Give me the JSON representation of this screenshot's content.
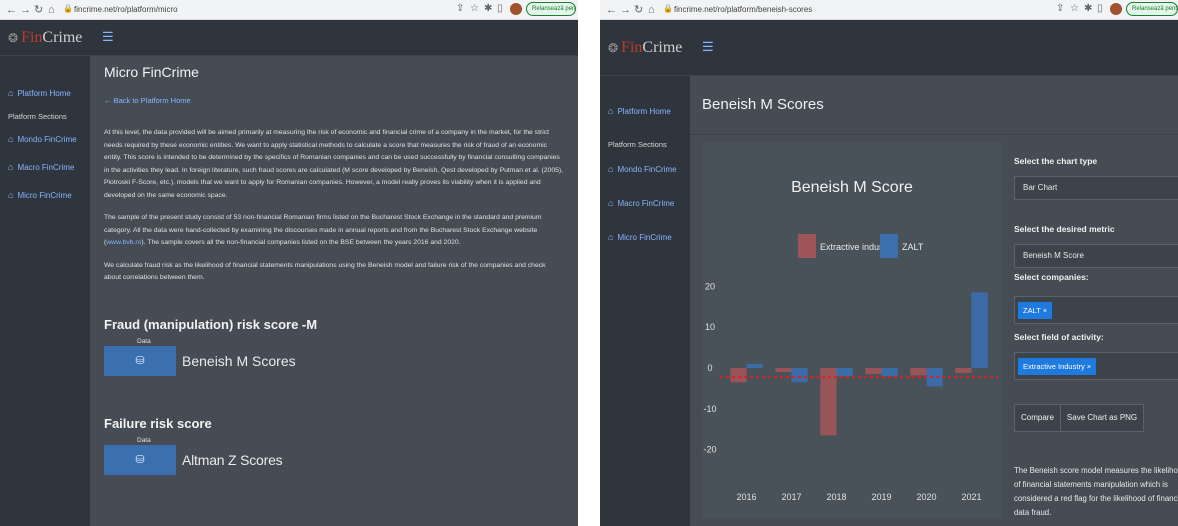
{
  "caption": "the figure is an example, ,",
  "left": {
    "browser": {
      "url": "fincrime.net/ro/platform/micro",
      "update_label": "Relansează pentru a actualiza"
    },
    "brand": {
      "fin": "Fin",
      "crime": "Crime"
    },
    "sidebar": {
      "home": "Platform Home",
      "section": "Platform Sections",
      "items": [
        "Mondo FinCrime",
        "Macro FinCrime",
        "Micro FinCrime"
      ]
    },
    "page": {
      "title": "Micro FinCrime",
      "back": "← Back to Platform Home",
      "p1": "At this level, the data provided will be aimed primarily at measuring the risk of economic and financial crime of a company in the market, for the strict needs required by these economic entities. We want to apply statistical methods to calculate a score that measures the risk of fraud of an economic entity. This score is intended to be determined by the specifics of Romanian companies and can be used successfully by financial consulting companies in the activities they lead. In foreign literature, such fraud scores are calculated (M score developed by Beneish, Qest developed by Putman et al. (2005), Piotroski F-Score, etc.), models that we want to apply for Romanian companies. However, a model really proves its viability when it is applied and developed on the same economic space.",
      "p2a": "The sample of the present study consist of 53 non-financial Romanian firms listed on the Bucharest Stock Exchange in the standard and premium category. All the data were hand-collected by examining the discourses made in annual reports and from the Bucharest Stock Exchange website (",
      "p2link": "www.bvb.ro",
      "p2b": "). The sample covers all the non-financial companies listed on the BSE between the years 2016 and 2020.",
      "p3": "We calculate fraud risk as the likelihood of financial statements manipulations using the Beneish model and failure risk of the companies and check about correlations between them.",
      "fraud_head": "Fraud (manipulation) risk score -M",
      "fraud_data": "Data",
      "fraud_btn": "Beneish M Scores",
      "fail_head": "Failure risk score",
      "fail_data": "Data",
      "fail_btn": "Altman Z Scores"
    }
  },
  "right": {
    "browser": {
      "url": "fincrime.net/ro/platform/beneish-scores",
      "update_label": "Relansează pentru a actualiza"
    },
    "brand": {
      "fin": "Fin",
      "crime": "Crime"
    },
    "sidebar": {
      "home": "Platform Home",
      "section": "Platform Sections",
      "items": [
        "Mondo FinCrime",
        "Macro FinCrime",
        "Micro FinCrime"
      ]
    },
    "page": {
      "title": "Beneish M Scores"
    },
    "controls": {
      "chart_type_label": "Select the chart type",
      "chart_type_value": "Bar Chart",
      "metric_label": "Select the desired metric",
      "metric_value": "Beneish M Score",
      "companies_label": "Select companies:",
      "company_tag": "ZALT ×",
      "field_label": "Select field of activity:",
      "field_tag": "Extractive Industry ×",
      "compare_btn": "Compare",
      "save_btn": "Save Chart as PNG",
      "description": "The Beneish score model measures the likelihood of financial statements manipulation which is considered a red flag for the likelihood of financial data fraud."
    },
    "colors": {
      "extractive": "#9e5558",
      "zalt": "#3b6fae",
      "threshold": "#e02020"
    }
  },
  "chart_data": {
    "type": "bar",
    "title": "Beneish M Score",
    "categories": [
      "2016",
      "2017",
      "2018",
      "2019",
      "2020",
      "2021"
    ],
    "series": [
      {
        "name": "Extractive industry",
        "values": [
          -3.5,
          -1.0,
          -16.5,
          -1.5,
          -1.8,
          -1.2
        ]
      },
      {
        "name": "ZALT",
        "values": [
          1.0,
          -3.5,
          -2.0,
          -2.0,
          -4.5,
          18.5
        ]
      }
    ],
    "threshold": -2.22,
    "ylim": [
      -24,
      24
    ],
    "yticks": [
      20,
      10,
      0,
      -10,
      -20
    ],
    "legend": "top",
    "xlabel": "",
    "ylabel": ""
  }
}
